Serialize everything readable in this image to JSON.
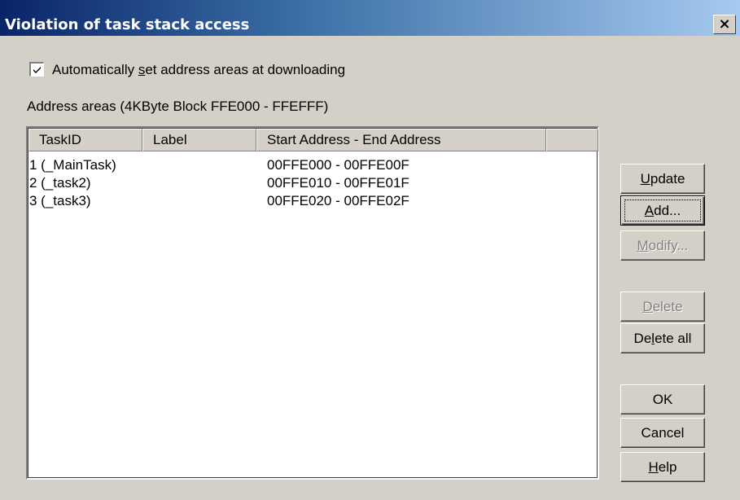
{
  "window": {
    "title": "Violation of task stack access",
    "close_glyph": "×"
  },
  "auto_checkbox": {
    "checked": true,
    "label_pre": "Automatically ",
    "label_accel": "s",
    "label_post": "et address areas at downloading"
  },
  "address_areas_label": "Address areas (4KByte Block  FFE000 - FFEFFF)",
  "list": {
    "columns": [
      "TaskID",
      "Label",
      "Start Address - End Address",
      ""
    ],
    "rows": [
      {
        "task_id": "1 (_MainTask)",
        "label": "",
        "range": "00FFE000 - 00FFE00F"
      },
      {
        "task_id": "2 (_task2)",
        "label": "",
        "range": "00FFE010 - 00FFE01F"
      },
      {
        "task_id": "3 (_task3)",
        "label": "",
        "range": "00FFE020 - 00FFE02F"
      }
    ]
  },
  "buttons": {
    "update": {
      "pre": "",
      "accel": "U",
      "post": "pdate",
      "enabled": true
    },
    "add": {
      "pre": "",
      "accel": "A",
      "post": "dd...",
      "enabled": true,
      "default": true
    },
    "modify": {
      "pre": "",
      "accel": "M",
      "post": "odify...",
      "enabled": false
    },
    "delete": {
      "pre": "",
      "accel": "D",
      "post": "elete",
      "enabled": false
    },
    "delete_all": {
      "pre": "De",
      "accel": "l",
      "post": "ete all",
      "enabled": true
    },
    "ok": {
      "label": "OK",
      "enabled": true
    },
    "cancel": {
      "label": "Cancel",
      "enabled": true
    },
    "help": {
      "pre": "",
      "accel": "H",
      "post": "elp",
      "enabled": true
    }
  }
}
